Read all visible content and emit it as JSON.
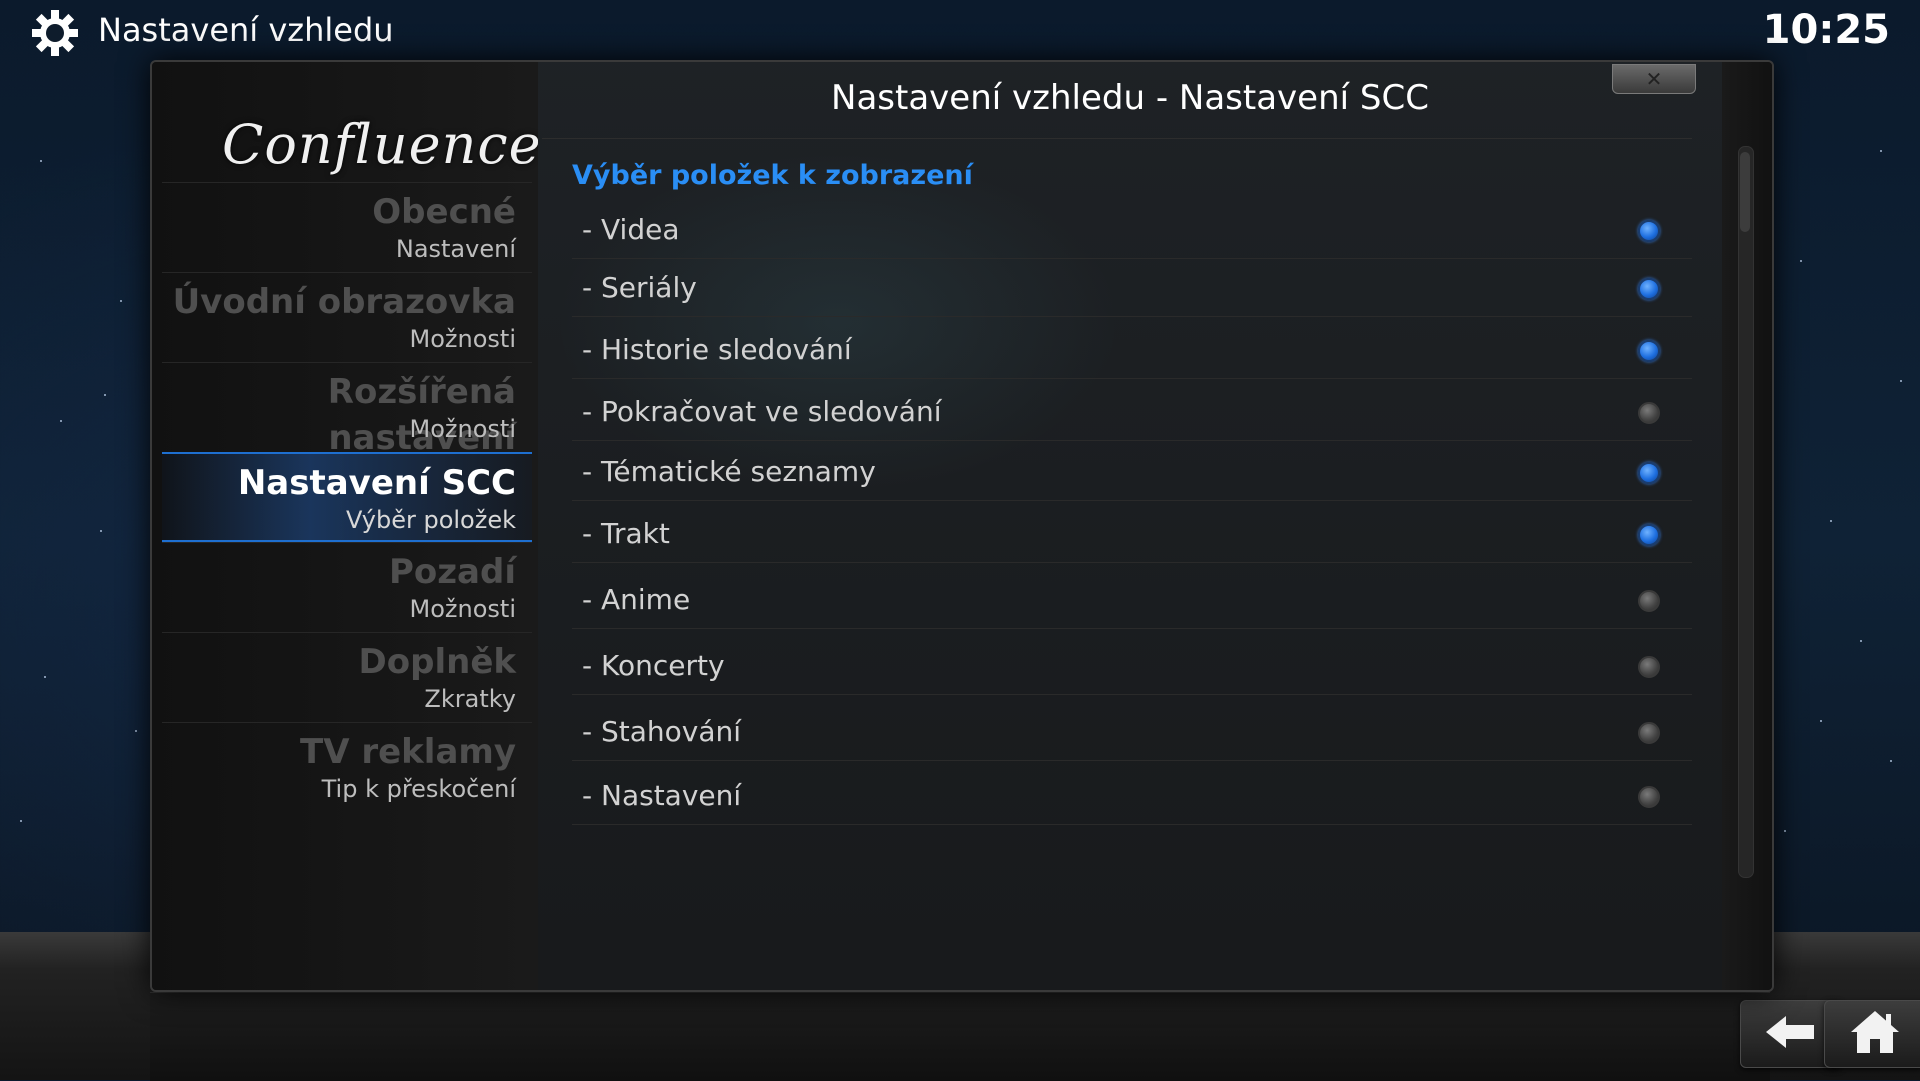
{
  "topbar": {
    "title": "Nastavení vzhledu",
    "clock": "10:25"
  },
  "dialog": {
    "logo": "Confluence",
    "title": "Nastavení vzhledu - Nastavení SCC",
    "close_label": "✕"
  },
  "sidebar": {
    "items": [
      {
        "title": "Obecné",
        "subtitle": "Nastavení",
        "active": false
      },
      {
        "title": "Úvodní obrazovka",
        "subtitle": "Možnosti",
        "active": false
      },
      {
        "title": "Rozšířená nastavení",
        "subtitle": "Možnosti",
        "active": false
      },
      {
        "title": "Nastavení SCC",
        "subtitle": "Výběr položek",
        "active": true
      },
      {
        "title": "Pozadí",
        "subtitle": "Možnosti",
        "active": false
      },
      {
        "title": "Doplněk",
        "subtitle": "Zkratky",
        "active": false
      },
      {
        "title": "TV reklamy",
        "subtitle": "Tip k přeskočení",
        "active": false
      }
    ]
  },
  "content": {
    "section_header": "Výběr položek k zobrazení",
    "options": [
      {
        "label": "- Videa",
        "enabled": true
      },
      {
        "label": "- Seriály",
        "enabled": true
      },
      {
        "label": "- Historie sledování",
        "enabled": true
      },
      {
        "label": "- Pokračovat ve sledování",
        "enabled": false
      },
      {
        "label": "- Tématické seznamy",
        "enabled": true
      },
      {
        "label": "- Trakt",
        "enabled": true
      },
      {
        "label": "- Anime",
        "enabled": false
      },
      {
        "label": "- Koncerty",
        "enabled": false
      },
      {
        "label": "- Stahování",
        "enabled": false
      },
      {
        "label": "- Nastavení",
        "enabled": false
      }
    ]
  },
  "icons": {
    "settings": "gear-icon",
    "back": "back-arrow-icon",
    "home": "home-icon"
  },
  "colors": {
    "accent": "#2a8ef5",
    "radio_on": "#1e6fe0",
    "radio_off": "#4a4a4a"
  }
}
